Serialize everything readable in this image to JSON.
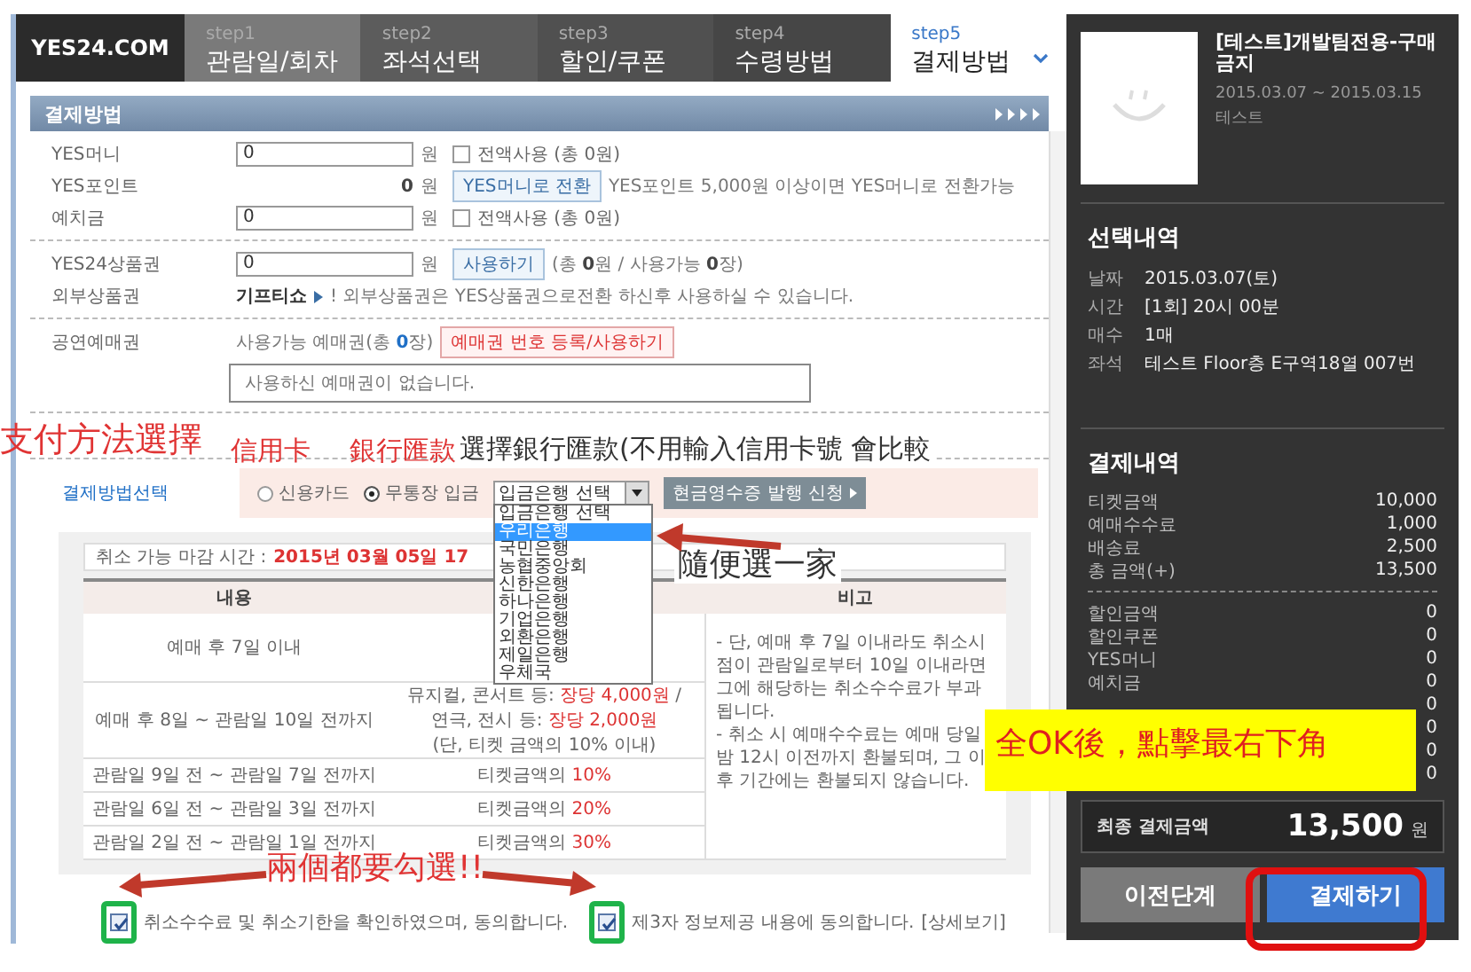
{
  "top_nav": {
    "logo": "YES24.COM",
    "steps": [
      {
        "step": "step1",
        "label": "관람일/회차",
        "selected": false
      },
      {
        "step": "step2",
        "label": "좌석선택",
        "selected": false
      },
      {
        "step": "step3",
        "label": "할인/쿠폰",
        "selected": false
      },
      {
        "step": "step4",
        "label": "수령방법",
        "selected": false
      },
      {
        "step": "step5",
        "label": "결제방법",
        "selected": true
      }
    ]
  },
  "section_title": "결제방법",
  "form_groups": [
    {
      "rows": [
        {
          "kind": "amount",
          "label": "YES머니",
          "value": "0",
          "unit": "원",
          "checkbox_label": "전액사용 (총 0원)",
          "checked": false
        },
        {
          "kind": "convert",
          "label": "YES포인트",
          "amount": "0",
          "unit": "원",
          "button": "YES머니로 전환",
          "note": "YES포인트 5,000원 이상이면 YES머니로 전환가능"
        },
        {
          "kind": "amount",
          "label": "예치금",
          "value": "0",
          "unit": "원",
          "checkbox_label": "전액사용 (총 0원)",
          "checked": false
        }
      ]
    },
    {
      "rows": [
        {
          "kind": "voucher",
          "label": "YES24상품권",
          "value": "0",
          "unit": "원",
          "button": "사용하기",
          "note": "(총 **0**원 / 사용가능 **0**장)"
        },
        {
          "kind": "external",
          "label": "외부상품권",
          "link": "기프티쇼",
          "note": "! 외부상품권은 YES상품권으로전환 하신후 사용하실 수 있습니다."
        }
      ]
    },
    {
      "rows": [
        {
          "kind": "ticket",
          "label": "공연예매권",
          "note": "사용가능 예매권(총 **0**장)",
          "button": "예매권 번호 등록/사용하기",
          "message": "사용하신 예매권이 없습니다."
        }
      ]
    }
  ],
  "payment": {
    "label": "결제방법선택",
    "methods": [
      {
        "label": "신용카드",
        "selected": false
      },
      {
        "label": "무통장 입금",
        "selected": true
      }
    ],
    "bank_select": "입금은행 선택",
    "bank_options": [
      {
        "label": "입금은행 선택",
        "selected": false
      },
      {
        "label": "우리은행",
        "selected": true
      },
      {
        "label": "국민은행",
        "selected": false
      },
      {
        "label": "농협중앙회",
        "selected": false
      },
      {
        "label": "신한은행",
        "selected": false
      },
      {
        "label": "하나은행",
        "selected": false
      },
      {
        "label": "기업은행",
        "selected": false
      },
      {
        "label": "외환은행",
        "selected": false
      },
      {
        "label": "제일은행",
        "selected": false
      },
      {
        "label": "우체국",
        "selected": false
      }
    ],
    "receipt_button": "현금영수증 발행 신청"
  },
  "cancellation": {
    "deadline_label": "취소 가능 마감 시간 :",
    "deadline": "2015년 03월 05일 17",
    "columns": {
      "column_1": "내용",
      "column_3": "비고"
    },
    "rows": [
      {
        "period": "예매 후 7일 이내"
      },
      {
        "period": "예매 후 8일 ~ 관람일 10일 전까지",
        "fee": [
          "뮤지컬, 콘서트 등: **장당 4,000원** /",
          "연극, 전시 등: **장당 2,000원**",
          "(단, 티켓 금액의 10% 이내)"
        ]
      },
      {
        "period": "관람일 9일 전 ~ 관람일 7일 전까지",
        "fee": [
          "티켓금액의 **10%**"
        ]
      },
      {
        "period": "관람일 6일 전 ~ 관람일 3일 전까지",
        "fee": [
          "티켓금액의 **20%**"
        ]
      },
      {
        "period": "관람일 2일 전 ~ 관람일 1일 전까지",
        "fee": [
          "티켓금액의 **30%**"
        ]
      }
    ],
    "remarks": [
      "- 단, 예매 후 7일 이내라도 취소시점이 관람일로부터 10일 이내라면 그에 해당하는 취소수수료가 부과됩니다.",
      "- 취소 시 예매수수료는 예매 당일 밤 12시 이전까지 환불되며, 그 이후 기간에는 환불되지 않습니다."
    ]
  },
  "agreements": [
    {
      "text": "취소수수료 및 취소기한을 확인하였으며, 동의합니다.",
      "checked": true
    },
    {
      "text": "제3자 정보제공 내용에 동의합니다.",
      "link": "[상세보기]",
      "checked": true
    }
  ],
  "summary": {
    "event": {
      "title": "[테스트]개발팀전용-구매금지",
      "dates": "2015.03.07 ~ 2015.03.15",
      "venue": "테스트"
    },
    "selection": {
      "title": "선택내역",
      "rows": [
        {
          "label": "날짜",
          "value": "2015.03.07(토)"
        },
        {
          "label": "시간",
          "value": "[1회] 20시 00분"
        },
        {
          "label": "매수",
          "value": "1매"
        },
        {
          "label": "좌석",
          "value": "테스트 Floor층 E구역18열 007번"
        }
      ]
    },
    "payment": {
      "title": "결제내역",
      "rows": [
        {
          "label": "티켓금액",
          "value": "10,000"
        },
        {
          "label": "예매수수료",
          "value": "1,000"
        },
        {
          "label": "배송료",
          "value": "2,500"
        },
        {
          "label": "총 금액(+)",
          "value": "13,500"
        }
      ],
      "discounts": [
        {
          "label": "할인금액",
          "value": "0"
        },
        {
          "label": "할인쿠폰",
          "value": "0"
        },
        {
          "label": "YES머니",
          "value": "0"
        },
        {
          "label": "예치금",
          "value": "0"
        },
        {
          "value": "0"
        },
        {
          "value": "0"
        },
        {
          "value": "0"
        },
        {
          "value": "0"
        }
      ]
    },
    "final": {
      "label": "최종 결제금액",
      "amount": "13,500",
      "unit": "원"
    },
    "buttons": [
      {
        "label": "이전단계",
        "kind": "secondary"
      },
      {
        "label": "결제하기",
        "kind": "primary"
      }
    ]
  },
  "annotations": [
    {
      "kind": "label",
      "text": "支付方法選擇"
    },
    {
      "kind": "label",
      "text": "信用卡"
    },
    {
      "kind": "label",
      "text": "銀行匯款"
    },
    {
      "kind": "note",
      "text": "選擇銀行匯款(不用輸入信用卡號 會比較"
    },
    {
      "kind": "note",
      "text": "隨便選一家"
    },
    {
      "kind": "callout",
      "text": "全OK後，點擊最右下角"
    },
    {
      "kind": "label",
      "text": "兩個都要勾選!!"
    }
  ]
}
